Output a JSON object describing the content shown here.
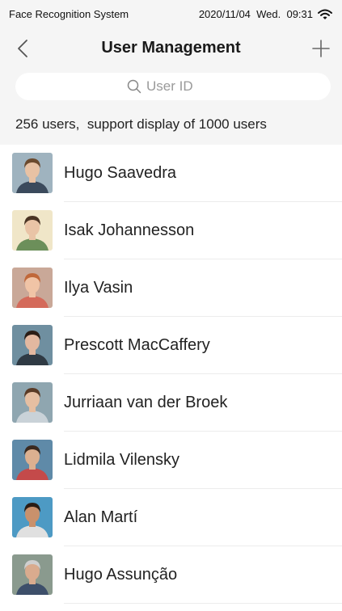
{
  "status_bar": {
    "app_name": "Face Recognition System",
    "datetime": "2020/11/04  Wed.  09:31",
    "wifi_icon": "wifi-icon"
  },
  "nav": {
    "title": "User Management",
    "back_icon": "chevron-left-icon",
    "add_icon": "plus-icon"
  },
  "search": {
    "placeholder": "User ID",
    "icon": "search-icon"
  },
  "summary": "256 users,  support display of 1000 users",
  "users": [
    {
      "name": "Hugo Saavedra",
      "bg": "#9fb3bf",
      "skin": "#e8c2a4",
      "hair": "#6b4a2e",
      "shirt": "#3b4a5c"
    },
    {
      "name": "Isak Johannesson",
      "bg": "#f0e6c8",
      "skin": "#e9c4a6",
      "hair": "#4a3424",
      "shirt": "#6c8f5a"
    },
    {
      "name": "Ilya Vasin",
      "bg": "#c9a898",
      "skin": "#f0c4a6",
      "hair": "#c0683a",
      "shirt": "#d46a5a"
    },
    {
      "name": "Prescott MacCaffery",
      "bg": "#6f8fa0",
      "skin": "#e3b8a0",
      "hair": "#2b1d16",
      "shirt": "#2f3a44"
    },
    {
      "name": "Jurriaan van der Broek",
      "bg": "#8fa6b0",
      "skin": "#e6bfa2",
      "hair": "#5a3b26",
      "shirt": "#c9d2d8"
    },
    {
      "name": "Lidmila Vilensky",
      "bg": "#5f8aa8",
      "skin": "#dcb090",
      "hair": "#3a2a20",
      "shirt": "#c44a4a"
    },
    {
      "name": "Alan Martí",
      "bg": "#4d9ac4",
      "skin": "#c9916c",
      "hair": "#2a1c14",
      "shirt": "#e0e0e0"
    },
    {
      "name": "Hugo Assunção",
      "bg": "#8a9a8e",
      "skin": "#d9ab8e",
      "hair": "#cfcfcf",
      "shirt": "#3d4f6a"
    }
  ]
}
